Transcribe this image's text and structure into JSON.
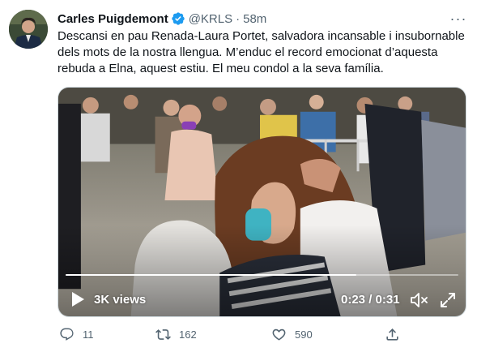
{
  "tweet": {
    "author_name": "Carles Puigdemont",
    "handle": "@KRLS",
    "separator": "·",
    "time": "58m",
    "more_label": "···",
    "text": "Descansi en pau Renada-Laura Portet, salvadora incansable i insubornable dels mots de la nostra llengua. M’enduc el record emocionat d’aquesta rebuda a Elna, aquest estiu. El meu condol a la seva família."
  },
  "video": {
    "views": "3K views",
    "timecode": "0:23 / 0:31",
    "progress_fraction": 0.74
  },
  "actions": {
    "replies": "11",
    "retweets": "162",
    "likes": "590"
  },
  "colors": {
    "verified": "#1d9bf0",
    "muted": "#536471",
    "text": "#0f1419"
  }
}
